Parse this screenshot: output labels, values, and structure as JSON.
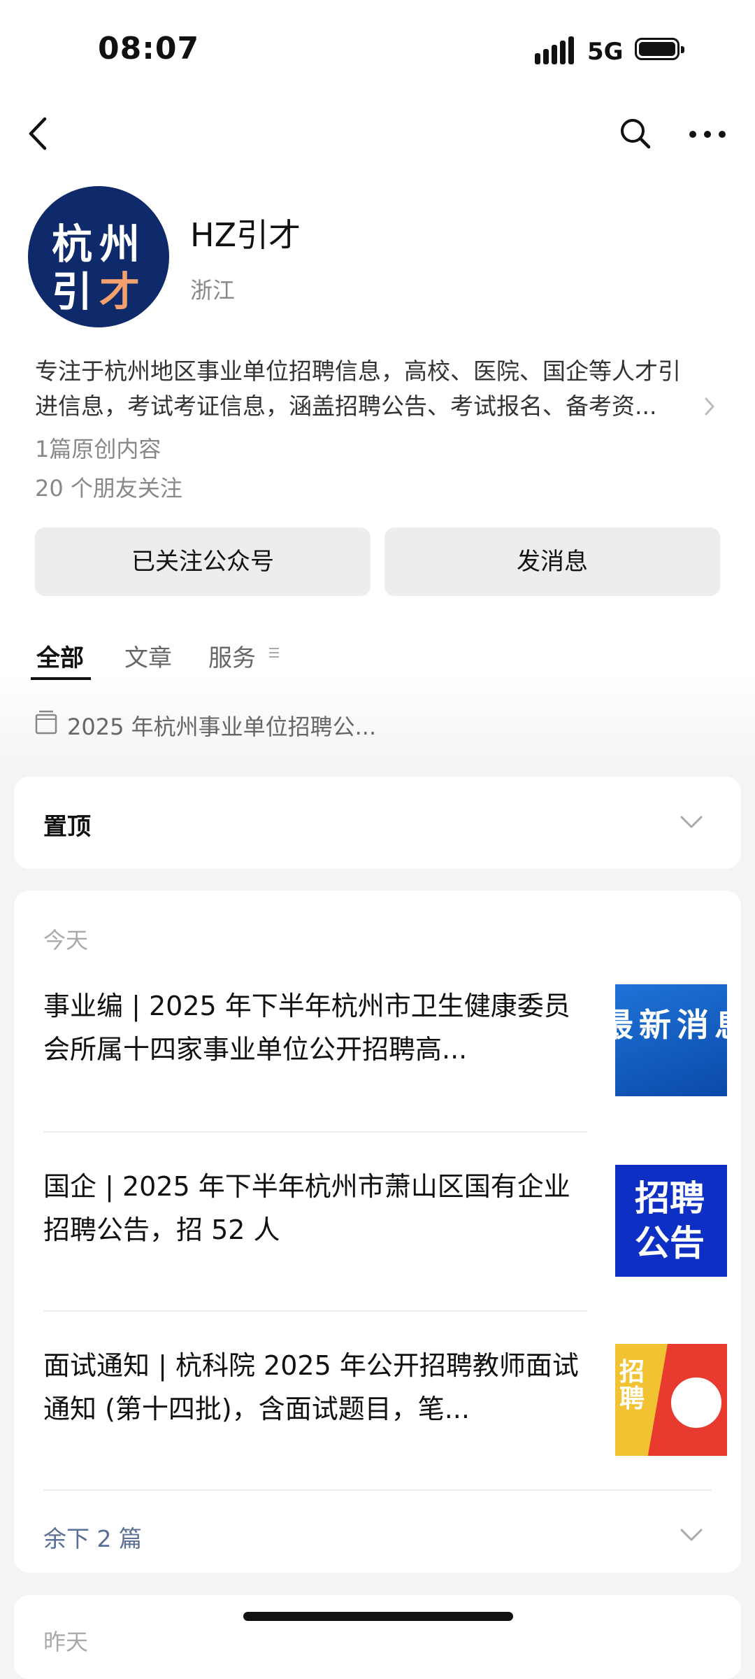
{
  "status_bar": {
    "time": "08:07",
    "network": "5G"
  },
  "profile": {
    "avatar_line1": "杭州",
    "avatar_line2a": "引",
    "avatar_line2b": "才",
    "name": "HZ引才",
    "region": "浙江",
    "description_line1": "专注于杭州地区事业单位招聘信息，高校、医院、国企等人才引",
    "description_line2": "进信息，考试考证信息，涵盖招聘公告、考试报名、备考资...",
    "original_count": "1篇原创内容",
    "friends_following": "20 个朋友关注"
  },
  "buttons": {
    "followed": "已关注公众号",
    "message": "发消息"
  },
  "tabs": {
    "all": "全部",
    "articles": "文章",
    "services": "服务"
  },
  "pinned_collection": "2025 年杭州事业单位招聘公...",
  "pinned_section": {
    "label": "置顶"
  },
  "today_section": {
    "label": "今天",
    "articles": [
      {
        "title": "事业编 | 2025 年下半年杭州市卫生健康委员会所属十四家事业单位公开招聘高...",
        "thumb_text": "最新消息"
      },
      {
        "title": "国企 | 2025 年下半年杭州市萧山区国有企业招聘公告，招 52 人",
        "thumb_line1": "招聘",
        "thumb_line2": "公告"
      },
      {
        "title": "面试通知 | 杭科院 2025 年公开招聘教师面试通知 (第十四批)，含面试题目，笔...",
        "thumb_text": "招聘"
      }
    ],
    "remaining": "余下 2 篇"
  },
  "yesterday_section": {
    "label": "昨天"
  }
}
